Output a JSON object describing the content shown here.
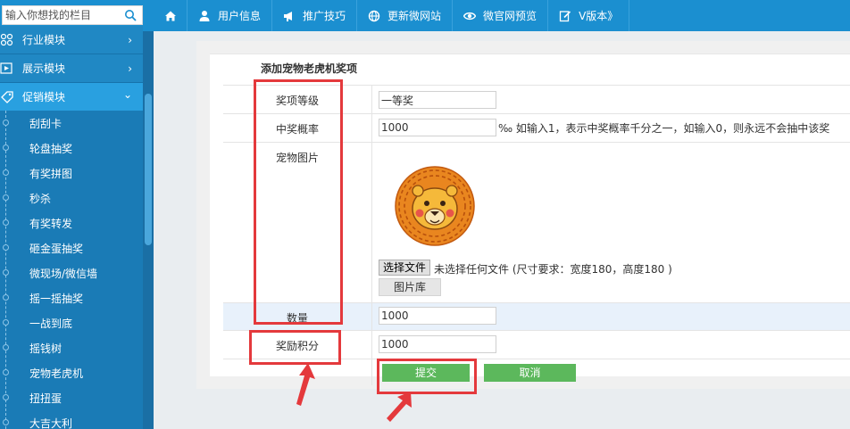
{
  "search": {
    "placeholder": "输入你想找的栏目"
  },
  "nav": [
    {
      "label": "用户信息"
    },
    {
      "label": "推广技巧"
    },
    {
      "label": "更新微网站"
    },
    {
      "label": "微官网预览"
    },
    {
      "label": "V版本》"
    }
  ],
  "sidebar": {
    "modules": [
      {
        "label": "行业模块",
        "arrow": "›"
      },
      {
        "label": "展示模块",
        "arrow": "›"
      },
      {
        "label": "促销模块",
        "arrow": "⌄"
      }
    ],
    "subitems": [
      "刮刮卡",
      "轮盘抽奖",
      "有奖拼图",
      "秒杀",
      "有奖转发",
      "砸金蛋抽奖",
      "微现场/微信墙",
      "摇一摇抽奖",
      "一战到底",
      "摇钱树",
      "宠物老虎机",
      "扭扭蛋",
      "大吉大利"
    ]
  },
  "form": {
    "title": "添加宠物老虎机奖项",
    "level_label": "奖项等级",
    "level_value": "一等奖",
    "prob_label": "中奖概率",
    "prob_value": "1000",
    "prob_hint": "‰ 如输入1，表示中奖概率千分之一，如输入0，则永远不会抽中该奖",
    "image_label": "宠物图片",
    "file_button": "选择文件",
    "file_status": "未选择任何文件 (尺寸要求：宽度180，高度180 )",
    "library_button": "图片库",
    "qty_label": "数量",
    "qty_value": "1000",
    "points_label": "奖励积分",
    "points_value": "1000",
    "submit_label": "提交",
    "cancel_label": "取消"
  },
  "colors": {
    "topbar": "#1b8fd0",
    "sidebar": "#1e7cb5",
    "accent_green": "#5cb85c",
    "annotation_red": "#e4393c"
  }
}
